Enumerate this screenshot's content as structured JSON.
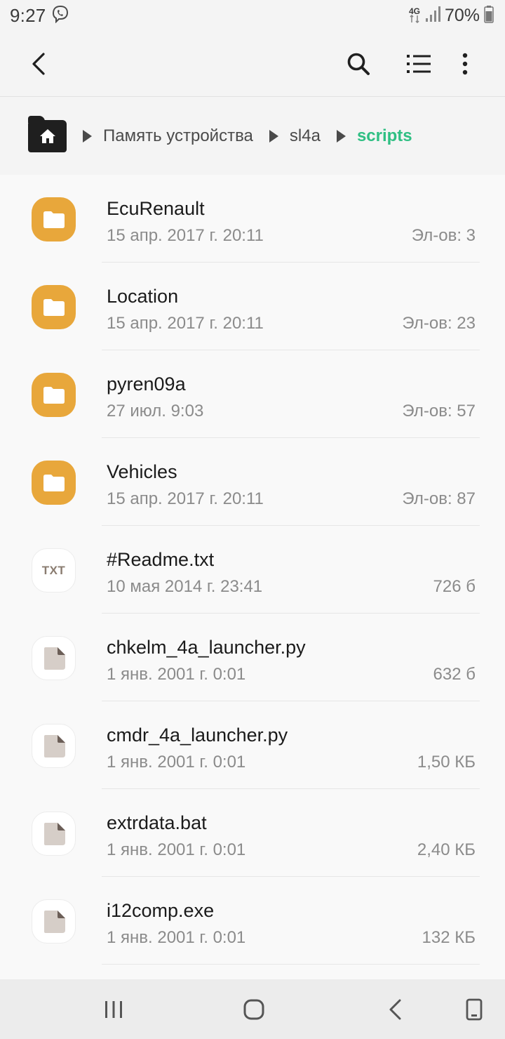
{
  "status_bar": {
    "time": "9:27",
    "network": "4G",
    "battery": "70%",
    "icons": [
      "viber-icon",
      "data-arrows-icon",
      "signal-icon",
      "battery-icon"
    ]
  },
  "toolbar": {
    "icons": [
      "back-arrow-icon",
      "search-icon",
      "list-view-icon",
      "more-vert-icon"
    ]
  },
  "breadcrumb": {
    "home_icon": "home-folder-icon",
    "items": [
      "Память устройства",
      "sl4a",
      "scripts"
    ]
  },
  "accent_color": "#2fbf83",
  "folder_color": "#e8a73b",
  "files": [
    {
      "name": "EcuRenault",
      "date": "15 апр. 2017 г. 20:11",
      "meta": "Эл-ов: 3",
      "kind": "folder"
    },
    {
      "name": "Location",
      "date": "15 апр. 2017 г. 20:11",
      "meta": "Эл-ов: 23",
      "kind": "folder"
    },
    {
      "name": "pyren09a",
      "date": "27 июл. 9:03",
      "meta": "Эл-ов: 57",
      "kind": "folder"
    },
    {
      "name": "Vehicles",
      "date": "15 апр. 2017 г. 20:11",
      "meta": "Эл-ов: 87",
      "kind": "folder"
    },
    {
      "name": "#Readme.txt",
      "date": "10 мая 2014 г. 23:41",
      "meta": "726 б",
      "kind": "txt",
      "icon_label": "TXT"
    },
    {
      "name": "chkelm_4a_launcher.py",
      "date": "1 янв. 2001 г. 0:01",
      "meta": "632 б",
      "kind": "file"
    },
    {
      "name": "cmdr_4a_launcher.py",
      "date": "1 янв. 2001 г. 0:01",
      "meta": "1,50 КБ",
      "kind": "file"
    },
    {
      "name": "extrdata.bat",
      "date": "1 янв. 2001 г. 0:01",
      "meta": "2,40 КБ",
      "kind": "file"
    },
    {
      "name": "i12comp.exe",
      "date": "1 янв. 2001 г. 0:01",
      "meta": "132 КБ",
      "kind": "file"
    }
  ],
  "navbar": {
    "icons": [
      "recent-apps-icon",
      "home-icon",
      "back-icon",
      "rotate-icon"
    ]
  }
}
